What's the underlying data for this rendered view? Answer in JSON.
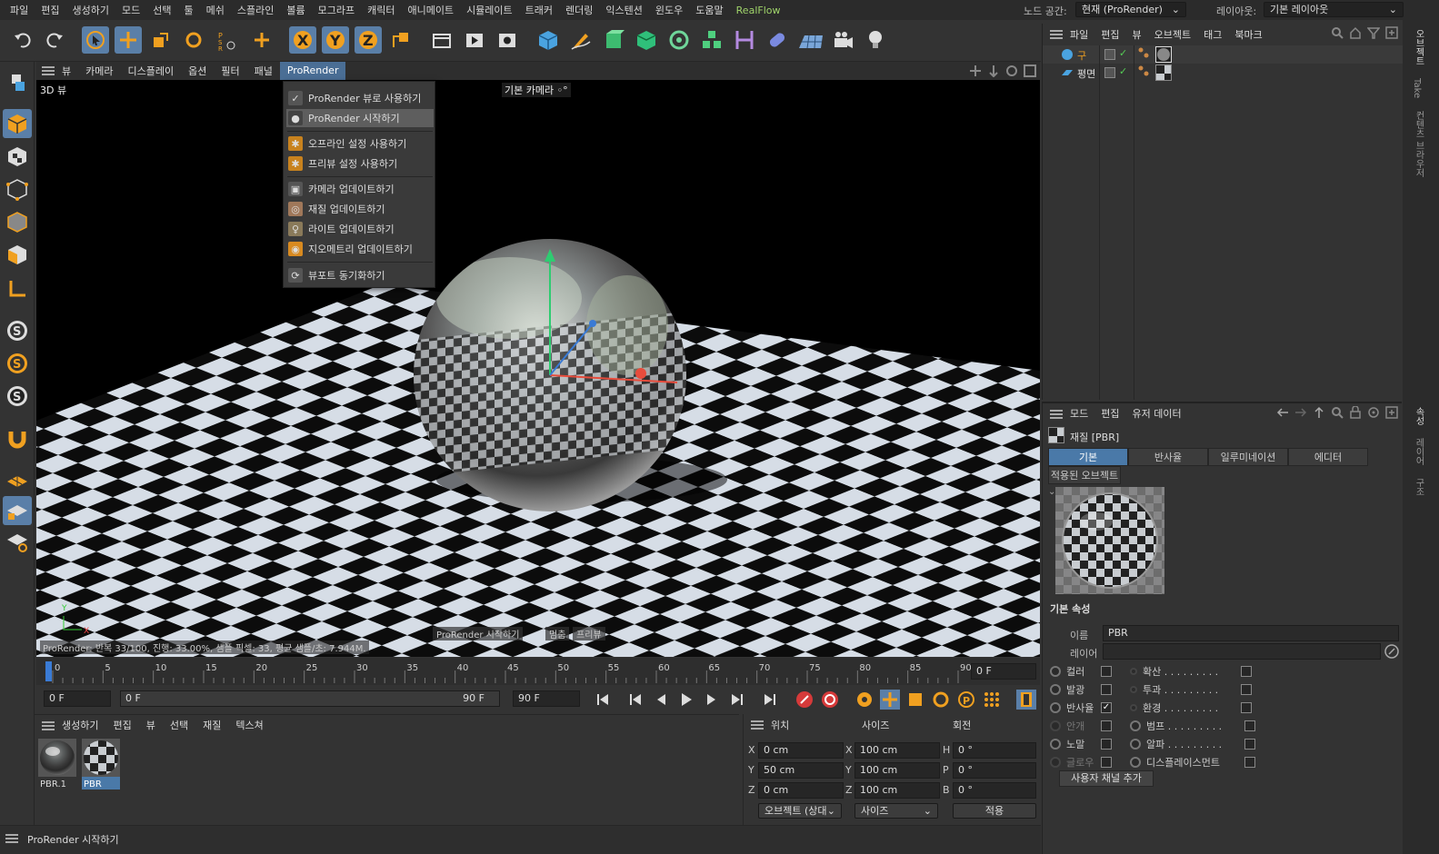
{
  "menubar": {
    "items": [
      "파일",
      "편집",
      "생성하기",
      "모드",
      "선택",
      "툴",
      "메쉬",
      "스플라인",
      "볼륨",
      "모그라프",
      "캐릭터",
      "애니메이트",
      "시뮬레이트",
      "트래커",
      "렌더링",
      "익스텐션",
      "윈도우",
      "도움말",
      "RealFlow"
    ],
    "node_space_label": "노드 공간:",
    "node_space_value": "현재 (ProRender)",
    "layout_label": "레이아웃:",
    "layout_value": "기본 레이아웃"
  },
  "viewport": {
    "menu": [
      "뷰",
      "카메라",
      "디스플레이",
      "옵션",
      "필터",
      "패널",
      "ProRender"
    ],
    "title": "3D 뷰",
    "camera_label": "기본 카메라 ◦°",
    "status": "ProRender: 반복 33/100, 진행: 33.00%, 샘플 픽셀: 33, 평균 샘플/초: 7.944M.",
    "overlay_buttons": [
      "ProRender 시작하기",
      "멈춤",
      "프리뷰"
    ],
    "axis_labels": [
      "Y",
      "X"
    ]
  },
  "dropdown": {
    "items": [
      {
        "label": "ProRender 뷰로 사용하기",
        "icon": "render-view-icon"
      },
      {
        "label": "ProRender 시작하기",
        "icon": "render-start-icon"
      },
      {
        "label": "오프라인 설정 사용하기",
        "icon": "settings-icon"
      },
      {
        "label": "프리뷰 설정 사용하기",
        "icon": "settings-icon"
      },
      {
        "label": "카메라 업데이트하기",
        "icon": "camera-icon"
      },
      {
        "label": "재질 업데이트하기",
        "icon": "material-icon"
      },
      {
        "label": "라이트 업데이트하기",
        "icon": "light-icon"
      },
      {
        "label": "지오메트리 업데이트하기",
        "icon": "geometry-icon"
      },
      {
        "label": "뷰포트 동기화하기",
        "icon": "sync-icon"
      }
    ]
  },
  "timeline": {
    "ticks": [
      "0",
      "5",
      "10",
      "15",
      "20",
      "25",
      "30",
      "35",
      "40",
      "45",
      "50",
      "55",
      "60",
      "65",
      "70",
      "75",
      "80",
      "85",
      "90"
    ],
    "current_frame": "0 F",
    "start": "0 F",
    "range_start": "0 F",
    "range_end": "90 F",
    "end": "90 F"
  },
  "material_manager": {
    "menu": [
      "생성하기",
      "편집",
      "뷰",
      "선택",
      "재질",
      "텍스쳐"
    ],
    "materials": [
      "PBR.1",
      "PBR"
    ]
  },
  "coord_manager": {
    "headers": [
      "위치",
      "사이즈",
      "회전"
    ],
    "rows": [
      {
        "axis": "X",
        "pos": "0 cm",
        "saxis": "X",
        "size": "100 cm",
        "raxis": "H",
        "rot": "0 °"
      },
      {
        "axis": "Y",
        "pos": "50 cm",
        "saxis": "Y",
        "size": "100 cm",
        "raxis": "P",
        "rot": "0 °"
      },
      {
        "axis": "Z",
        "pos": "0 cm",
        "saxis": "Z",
        "size": "100 cm",
        "raxis": "B",
        "rot": "0 °"
      }
    ],
    "mode_select": "오브젝트 (상대",
    "size_select": "사이즈",
    "apply": "적용"
  },
  "status_bar": "ProRender 시작하기",
  "object_manager": {
    "menu": [
      "파일",
      "편집",
      "뷰",
      "오브젝트",
      "태그",
      "북마크"
    ],
    "objects": [
      "구",
      "평면"
    ]
  },
  "attribute_manager": {
    "menu": [
      "모드",
      "편집",
      "유저 데이터"
    ],
    "title": "재질 [PBR]",
    "tabs": [
      "기본",
      "반사율",
      "일루미네이션",
      "에디터"
    ],
    "subtab": "적용된 오브젝트",
    "section": "기본 속성",
    "name_label": "이름",
    "name_value": "PBR",
    "layer_label": "레이어",
    "channels_left": [
      {
        "label": "컬러",
        "checked": false
      },
      {
        "label": "발광",
        "checked": false
      },
      {
        "label": "반사율",
        "checked": true
      },
      {
        "label": "안개",
        "checked": false
      },
      {
        "label": "노말",
        "checked": false
      },
      {
        "label": "글로우",
        "checked": false
      }
    ],
    "channels_right": [
      {
        "label": "확산 . . . . . . . . .",
        "checked": false
      },
      {
        "label": "투과 . . . . . . . . .",
        "checked": false
      },
      {
        "label": "환경 . . . . . . . . .",
        "checked": false
      },
      {
        "label": "범프 . . . . . . . . .",
        "checked": false
      },
      {
        "label": "알파 . . . . . . . . .",
        "checked": false
      },
      {
        "label": "디스플레이스먼트",
        "checked": false
      }
    ],
    "add_channel": "사용자 채널 추가"
  },
  "right_strip": {
    "tabs_top": [
      "오브젝트",
      "Take",
      "컨텐츠 브라우저"
    ],
    "tabs_bottom": [
      "속성",
      "레이어",
      "구조"
    ]
  }
}
